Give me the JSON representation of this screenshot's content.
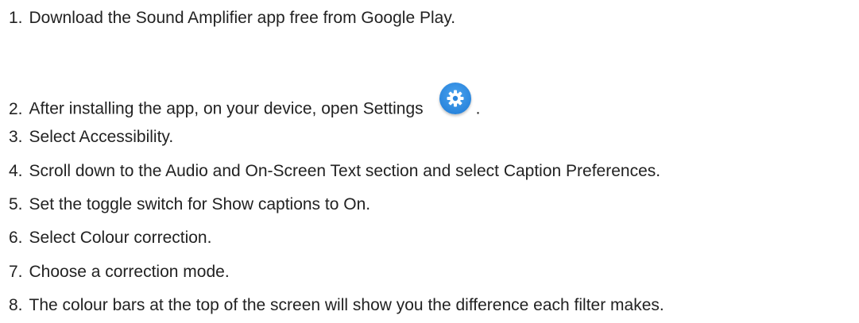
{
  "steps": [
    {
      "num": "1.",
      "text": "Download the Sound Amplifier app free from Google Play."
    },
    {
      "num": "2.",
      "text": "After installing the app, on your device, open Settings",
      "suffix": ".",
      "icon": "settings-gear-icon",
      "icon_color": "#2b86dd"
    },
    {
      "num": "3.",
      "text": "Select Accessibility."
    },
    {
      "num": "4.",
      "text": "Scroll down to the Audio and On-Screen Text section and select Caption Preferences."
    },
    {
      "num": "5.",
      "text": "Set the toggle switch for Show captions to On."
    },
    {
      "num": "6.",
      "text": "Select Colour correction."
    },
    {
      "num": "7.",
      "text": "Choose a correction mode."
    },
    {
      "num": "8.",
      "text": "The colour bars at the top of the screen will show you the difference each filter makes."
    }
  ]
}
